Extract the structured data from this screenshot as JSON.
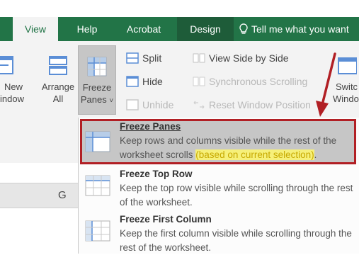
{
  "tabs": [
    {
      "label": "View",
      "state": "active"
    },
    {
      "label": "Help"
    },
    {
      "label": "Acrobat"
    },
    {
      "label": "Design",
      "state": "selected-dark"
    }
  ],
  "tell_me": {
    "label": "Tell me what you want",
    "icon": "lightbulb-icon"
  },
  "ribbon": {
    "new_window": {
      "line1": "New",
      "line2": "indow",
      "icon": "new-window-icon"
    },
    "arrange_all": {
      "line1": "Arrange",
      "line2": "All",
      "icon": "arrange-all-icon"
    },
    "freeze_panes": {
      "line1": "Freeze",
      "line2": "Panes",
      "caret": "˅",
      "icon": "freeze-panes-icon"
    },
    "split": {
      "label": "Split",
      "icon": "split-icon"
    },
    "hide": {
      "label": "Hide",
      "icon": "hide-icon"
    },
    "unhide": {
      "label": "Unhide",
      "icon": "unhide-icon",
      "disabled": true
    },
    "view_side_by_side": {
      "label": "View Side by Side",
      "icon": "side-by-side-icon"
    },
    "synchronous_scrolling": {
      "label": "Synchronous Scrolling",
      "icon": "sync-scroll-icon",
      "disabled": true
    },
    "reset_window_position": {
      "label": "Reset Window Position",
      "icon": "reset-window-icon",
      "disabled": true
    },
    "switch_windows": {
      "line1": "Switc",
      "line2": "Window",
      "icon": "switch-windows-icon"
    }
  },
  "sheet": {
    "column_label": "G"
  },
  "menu": [
    {
      "title": "Freeze Panes",
      "desc_main": "Keep rows and columns visible while the rest of the worksheet scrolls",
      "desc_hint": "(based on current selection)",
      "desc_end": ".",
      "icon": "freeze-panes-icon",
      "highlighted": true
    },
    {
      "title": "Freeze Top Row",
      "desc_main": "Keep the top row visible while scrolling through the rest of the worksheet.",
      "icon": "freeze-top-row-icon"
    },
    {
      "title": "Freeze First Column",
      "desc_main": "Keep the first column visible while scrolling through the rest of the worksheet.",
      "icon": "freeze-first-column-icon"
    }
  ],
  "colors": {
    "tab_green": "#227447",
    "highlight_border": "#b11f24",
    "annotation_yellow": "#f6f07a"
  }
}
